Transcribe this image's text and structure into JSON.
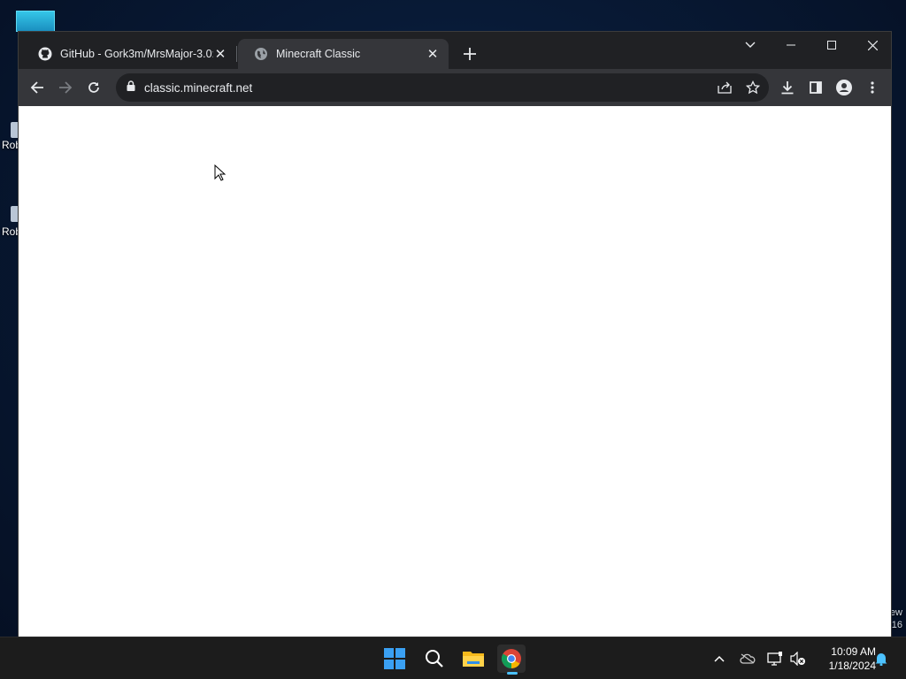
{
  "desktop": {
    "icon_labels": [
      "Rob",
      "Rob"
    ],
    "edge_texts": [
      "ew",
      "16"
    ]
  },
  "browser": {
    "tabs": [
      {
        "title": "GitHub - Gork3m/MrsMajor-3.0: ",
        "favicon": "github-icon",
        "active": false
      },
      {
        "title": "Minecraft Classic",
        "favicon": "globe-icon",
        "active": true
      }
    ],
    "new_tab_icon": "plus-icon",
    "url": "classic.minecraft.net",
    "lock_icon": "lock-icon",
    "colors": {
      "tabstrip": "#202124",
      "toolbar": "#35363a",
      "omnibox": "#202124",
      "page": "#ffffff"
    }
  },
  "taskbar": {
    "apps": [
      "start-icon",
      "search-icon",
      "file-explorer-icon",
      "chrome-icon"
    ],
    "time": "10:09 AM",
    "date": "1/18/2024",
    "accent": "#4cc2ff"
  }
}
